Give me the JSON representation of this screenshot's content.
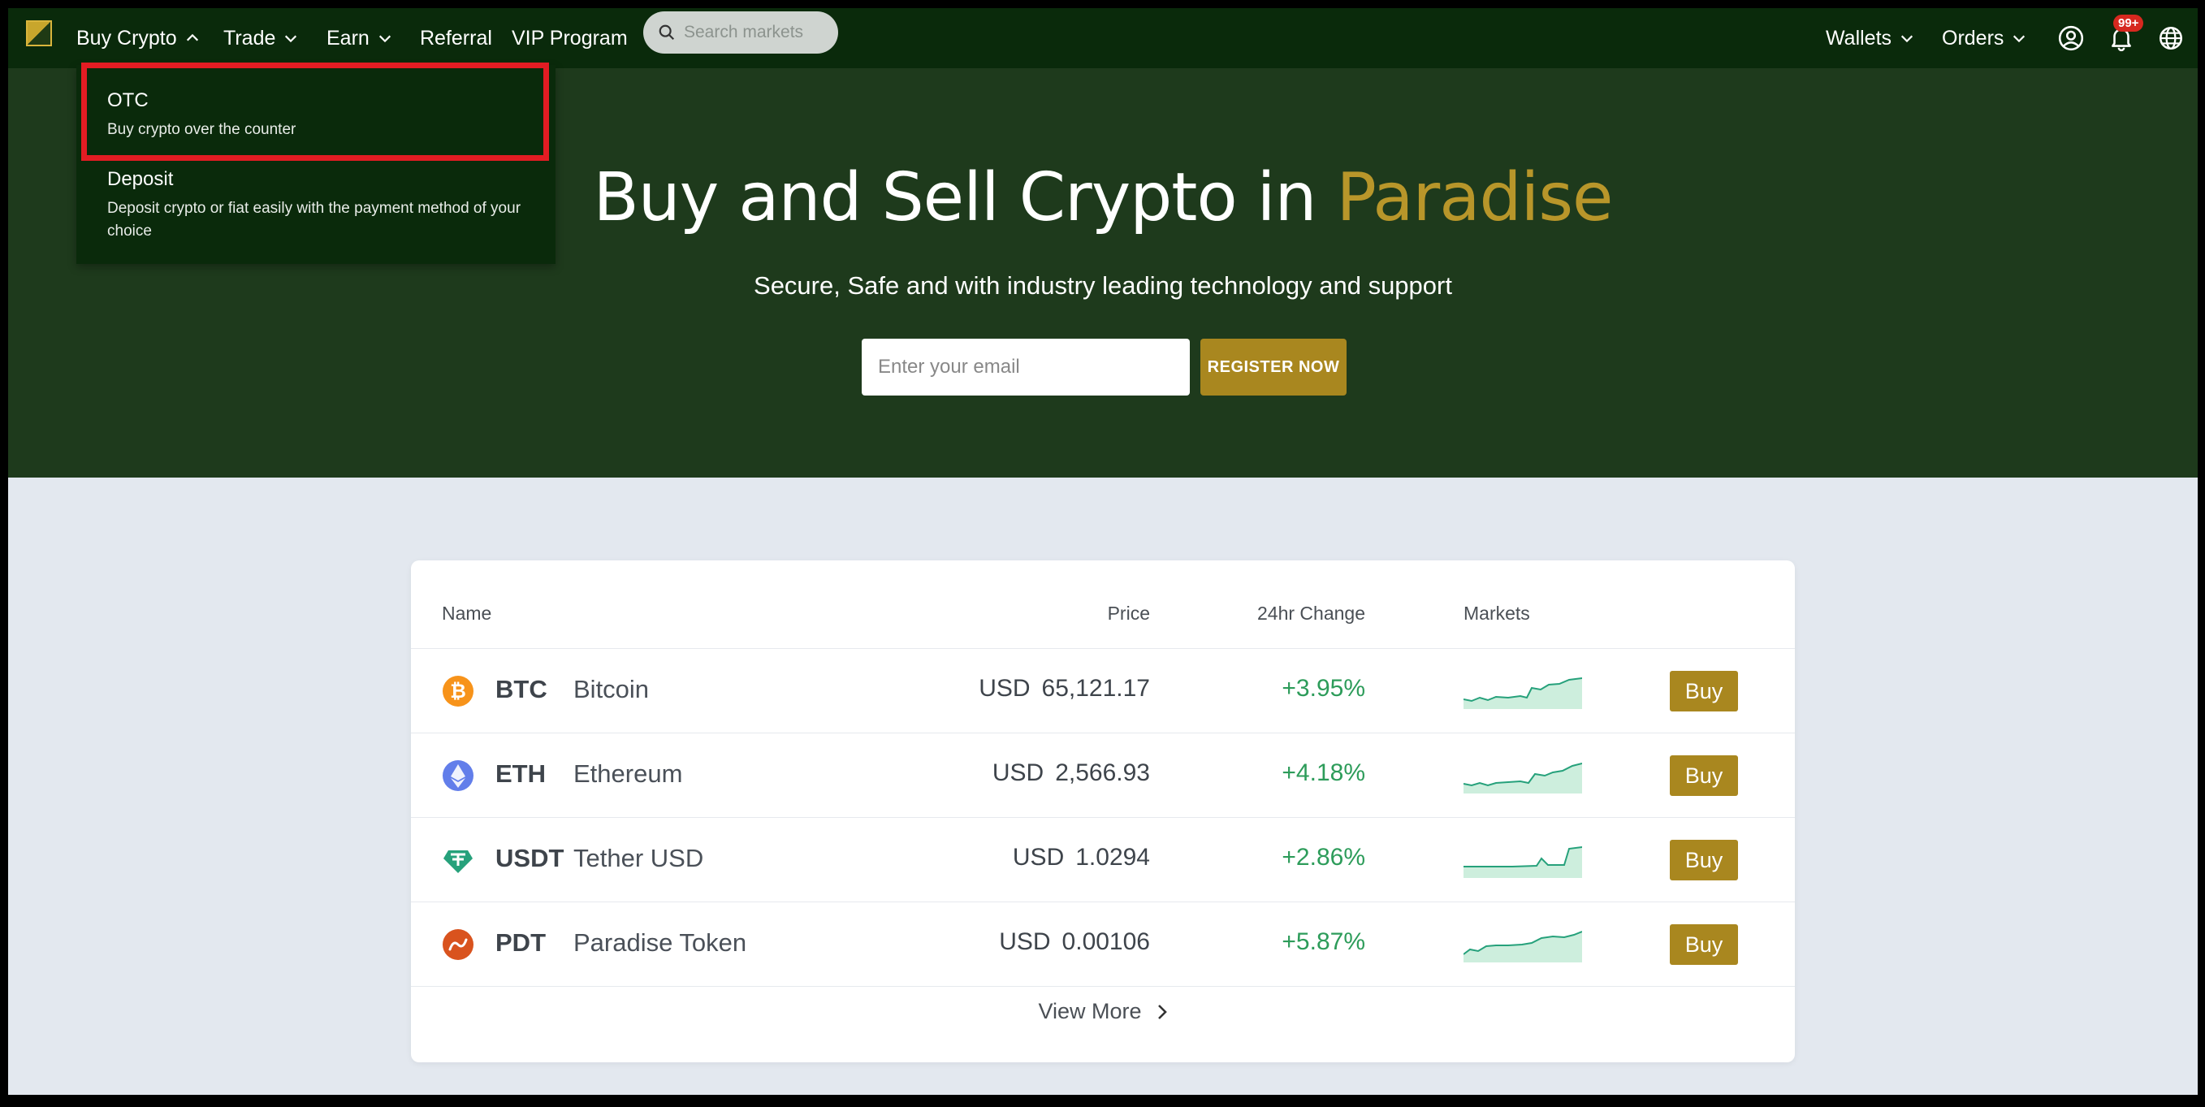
{
  "nav": {
    "items": [
      {
        "label": "Buy Crypto",
        "open": true
      },
      {
        "label": "Trade"
      },
      {
        "label": "Earn"
      },
      {
        "label": "Referral"
      },
      {
        "label": "VIP Program"
      }
    ],
    "search_placeholder": "Search markets",
    "right": [
      {
        "label": "Wallets"
      },
      {
        "label": "Orders"
      }
    ],
    "notification_count": "99+"
  },
  "dropdown": {
    "items": [
      {
        "title": "OTC",
        "desc": "Buy crypto over the counter"
      },
      {
        "title": "Deposit",
        "desc": "Deposit crypto or fiat easily with the payment method of your choice"
      }
    ]
  },
  "hero": {
    "title_main": "Buy and Sell Crypto in",
    "title_accent": "Paradise",
    "subtitle": "Secure, Safe and with industry leading technology and support",
    "email_placeholder": "Enter your email",
    "register_label": "REGISTER NOW"
  },
  "market_table": {
    "headers": {
      "name": "Name",
      "price": "Price",
      "change": "24hr Change",
      "markets": "Markets"
    },
    "rows": [
      {
        "symbol": "BTC",
        "name": "Bitcoin",
        "currency": "USD",
        "price": "65,121.17",
        "change": "+3.95%",
        "buy": "Buy",
        "icon": "bitcoin-icon",
        "color": "#f7931a"
      },
      {
        "symbol": "ETH",
        "name": "Ethereum",
        "currency": "USD",
        "price": "2,566.93",
        "change": "+4.18%",
        "buy": "Buy",
        "icon": "ethereum-icon",
        "color": "#627eea"
      },
      {
        "symbol": "USDT",
        "name": "Tether USD",
        "currency": "USD",
        "price": "1.0294",
        "change": "+2.86%",
        "buy": "Buy",
        "icon": "tether-icon",
        "color": "#26a17b"
      },
      {
        "symbol": "PDT",
        "name": "Paradise Token",
        "currency": "USD",
        "price": "0.00106",
        "change": "+5.87%",
        "buy": "Buy",
        "icon": "paradise-token-icon",
        "color": "#d9531e"
      }
    ],
    "view_more": "View More"
  },
  "colors": {
    "nav_bg": "#0a2a0b",
    "hero_bg": "#1e3a1c",
    "accent_gold": "#a9871f",
    "positive_green": "#2d9c5a",
    "highlight_red": "#e31c23"
  }
}
